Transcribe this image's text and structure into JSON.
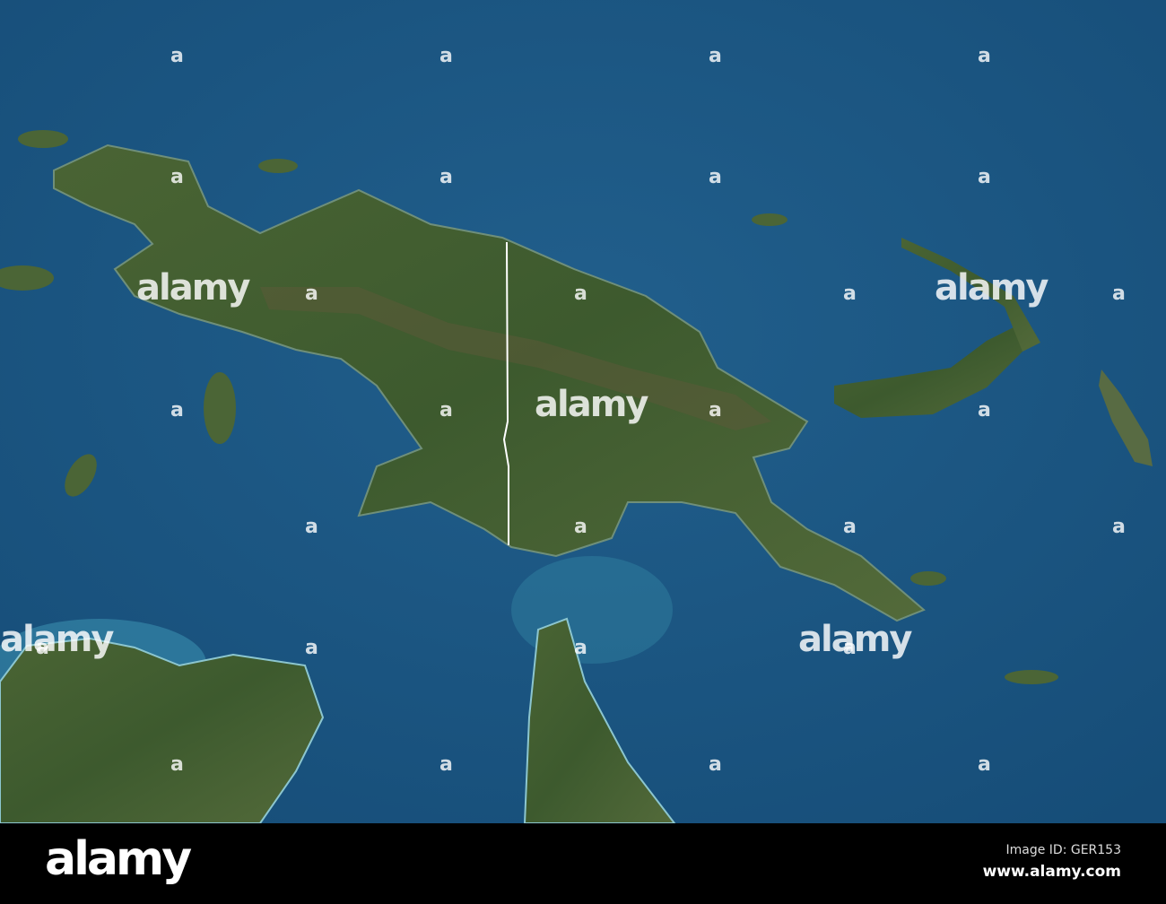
{
  "watermark": {
    "text": "alamy",
    "mark": "a"
  },
  "footer": {
    "logo": "alamy",
    "image_id": "Image ID: GER153",
    "site": "www.alamy.com"
  },
  "colors": {
    "ocean": "#1d5b86",
    "land": "#3f5a2e",
    "border": "#ffffff"
  }
}
